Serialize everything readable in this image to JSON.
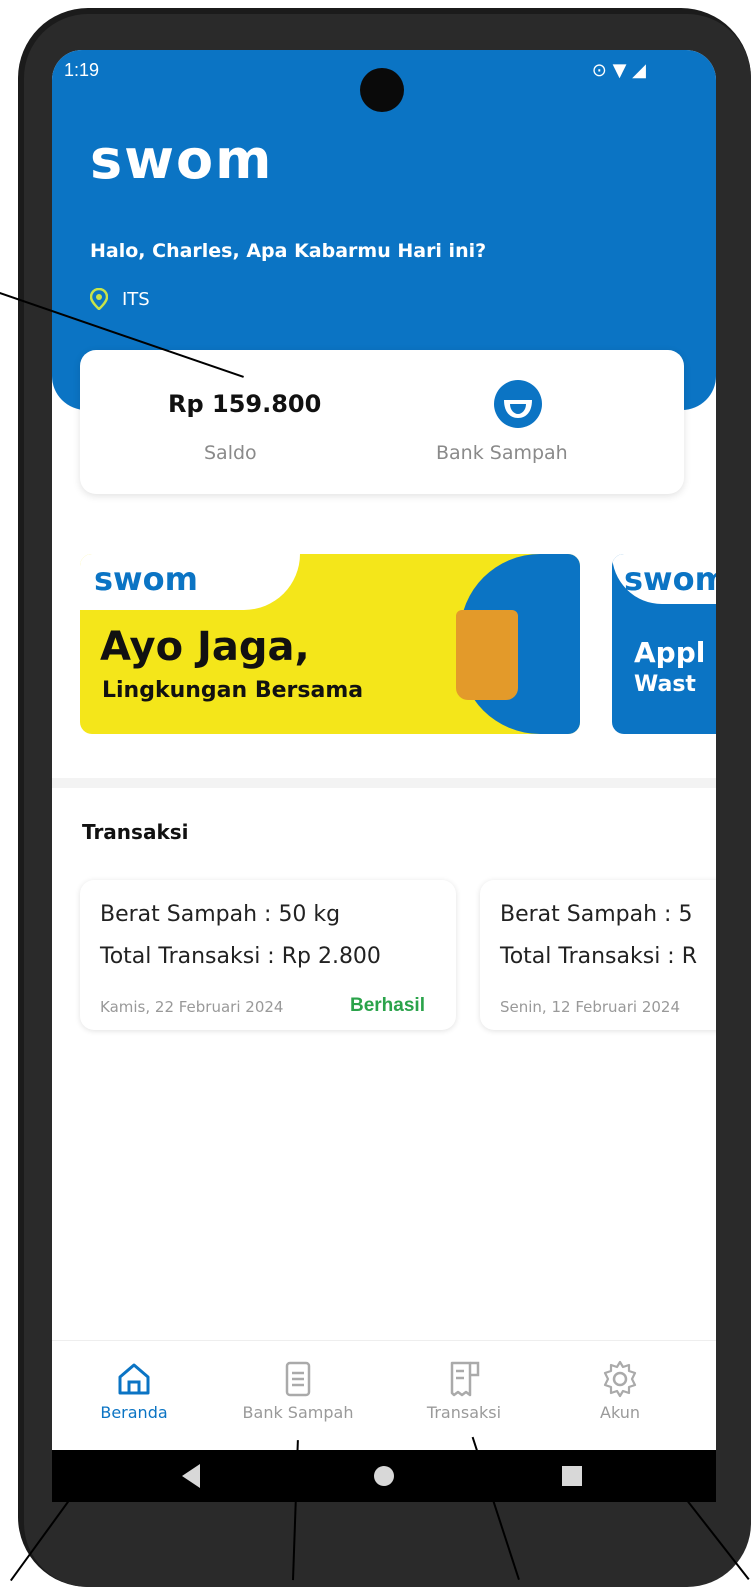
{
  "status_bar": {
    "time": "1:19",
    "icons": [
      "settings-icon",
      "sd-card-icon",
      "location-icon",
      "wifi-icon",
      "signal-icon"
    ]
  },
  "header": {
    "logo": "swom",
    "greeting": "Halo, Charles, Apa Kabarmu Hari ini?",
    "location": "ITS"
  },
  "balance_card": {
    "amount": "Rp 159.800",
    "amount_label": "Saldo",
    "bank_label": "Bank Sampah"
  },
  "banners": [
    {
      "logo": "swom",
      "headline": "Ayo Jaga,",
      "subline": "Lingkungan Bersama"
    },
    {
      "logo": "swom",
      "headline": "Appl",
      "subline": "Wast"
    }
  ],
  "transactions": {
    "title": "Transaksi",
    "items": [
      {
        "weight": "Berat Sampah : 50 kg",
        "total": "Total Transaksi : Rp 2.800",
        "date": "Kamis, 22 Februari 2024",
        "status": "Berhasil"
      },
      {
        "weight": "Berat Sampah : 5",
        "total": "Total Transaksi : R",
        "date": "Senin, 12 Februari 2024",
        "status": ""
      }
    ]
  },
  "bottom_nav": {
    "items": [
      {
        "label": "Beranda",
        "icon": "home-icon",
        "active": true
      },
      {
        "label": "Bank Sampah",
        "icon": "document-icon",
        "active": false
      },
      {
        "label": "Transaksi",
        "icon": "receipt-icon",
        "active": false
      },
      {
        "label": "Akun",
        "icon": "gear-icon",
        "active": false
      }
    ]
  },
  "colors": {
    "primary": "#0b74c4",
    "accent_yellow": "#f4e61a",
    "success": "#2aa34a"
  }
}
